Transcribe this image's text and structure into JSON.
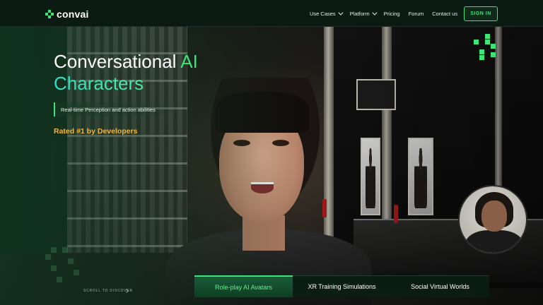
{
  "nav": {
    "logo_text": "convai",
    "items": [
      {
        "label": "Use Cases",
        "has_dropdown": true
      },
      {
        "label": "Platform",
        "has_dropdown": true
      },
      {
        "label": "Pricing",
        "has_dropdown": false
      },
      {
        "label": "Forum",
        "has_dropdown": false
      },
      {
        "label": "Contact us",
        "has_dropdown": false
      }
    ],
    "signin_label": "SIGN IN"
  },
  "hero": {
    "title_part1": "Conversational ",
    "title_part2": "AI",
    "title_line2": "Characters",
    "subtitle": "Real-time Perception and action abilities",
    "rated": "Rated #1 by Developers"
  },
  "scroll_hint": "SCROLL TO DISCOVER",
  "tabs": [
    {
      "label": "Role-play AI Avatars",
      "active": true
    },
    {
      "label": "XR Training Simulations",
      "active": false
    },
    {
      "label": "Social Virtual Worlds",
      "active": false
    }
  ],
  "icons": {
    "logo": "convai-logo-icon",
    "dropdown": "chevron-down-icon",
    "scroll": "chevron-right-icon"
  },
  "colors": {
    "accent": "#3ee37a",
    "rated": "#f2b53a",
    "nav_bg": "#0b1a12"
  }
}
